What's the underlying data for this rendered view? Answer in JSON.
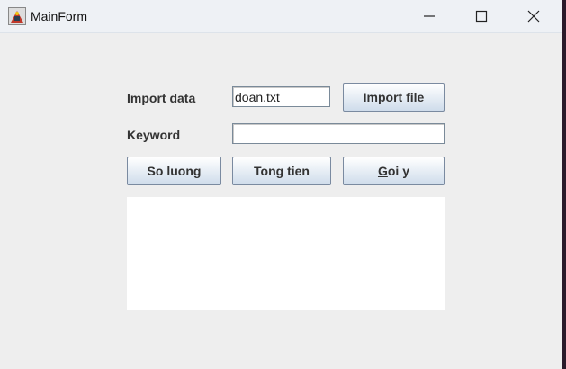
{
  "window": {
    "title": "MainForm"
  },
  "form": {
    "import_label": "Import data",
    "import_value": "doan.txt",
    "import_button": "Import file",
    "keyword_label": "Keyword",
    "keyword_value": "",
    "so_luong_button": "So luong",
    "tong_tien_button": "Tong tien",
    "goi_y_button_mnemonic": "G",
    "goi_y_button_rest": "oi y",
    "result_text": ""
  },
  "icons": {
    "app": "java-app-icon",
    "minimize": "minimize-icon",
    "maximize": "maximize-icon",
    "close": "close-icon"
  }
}
